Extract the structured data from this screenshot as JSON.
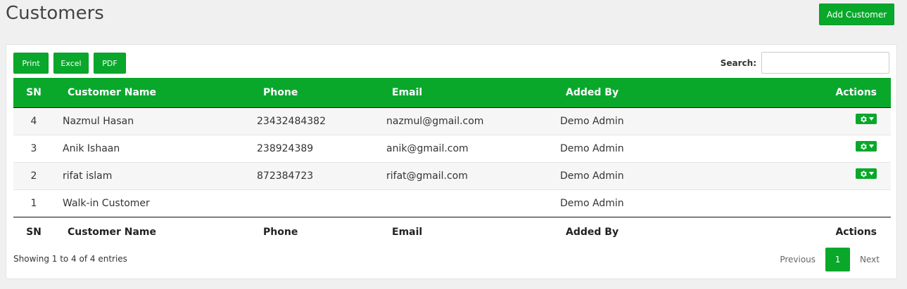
{
  "page": {
    "title": "Customers",
    "add_button": "Add Customer"
  },
  "toolbar": {
    "print": "Print",
    "excel": "Excel",
    "pdf": "PDF",
    "search_label": "Search:",
    "search_value": ""
  },
  "table": {
    "headers": [
      "SN",
      "Customer Name",
      "Phone",
      "Email",
      "Added By",
      "Actions"
    ],
    "rows": [
      {
        "sn": "4",
        "name": "Nazmul Hasan",
        "phone": "23432484382",
        "email": "nazmul@gmail.com",
        "added_by": "Demo Admin",
        "has_action": true
      },
      {
        "sn": "3",
        "name": "Anik Ishaan",
        "phone": "238924389",
        "email": "anik@gmail.com",
        "added_by": "Demo Admin",
        "has_action": true
      },
      {
        "sn": "2",
        "name": "rifat islam",
        "phone": "872384723",
        "email": "rifat@gmail.com",
        "added_by": "Demo Admin",
        "has_action": true
      },
      {
        "sn": "1",
        "name": "Walk-in Customer",
        "phone": "",
        "email": "",
        "added_by": "Demo Admin",
        "has_action": false
      }
    ]
  },
  "footer": {
    "info": "Showing 1 to 4 of 4 entries",
    "prev": "Previous",
    "page": "1",
    "next": "Next"
  },
  "colors": {
    "accent": "#09a82b"
  },
  "icons": {
    "action": "gear-caret-icon"
  }
}
